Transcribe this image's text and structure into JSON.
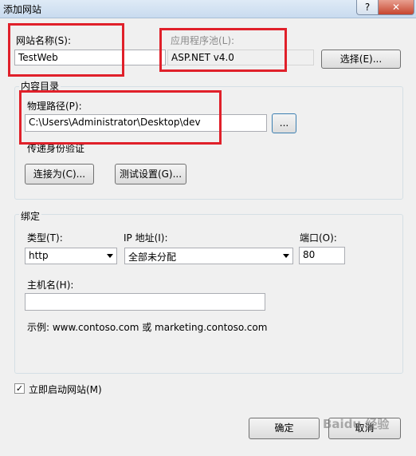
{
  "window": {
    "title": "添加网站",
    "help_label": "?",
    "close_label": "✕"
  },
  "site_name": {
    "label": "网站名称(S):",
    "value": "TestWeb"
  },
  "app_pool": {
    "label": "应用程序池(L):",
    "value": "ASP.NET v4.0",
    "select_button": "选择(E)..."
  },
  "content_dir": {
    "group_title": "内容目录",
    "physical_path_label": "物理路径(P):",
    "physical_path_value": "C:\\Users\\Administrator\\Desktop\\dev",
    "browse_button": "...",
    "pass_auth_label": "传递身份验证",
    "connect_as_button": "连接为(C)...",
    "test_settings_button": "测试设置(G)..."
  },
  "binding": {
    "group_title": "绑定",
    "type_label": "类型(T):",
    "type_value": "http",
    "ip_label": "IP 地址(I):",
    "ip_value": "全部未分配",
    "port_label": "端口(O):",
    "port_value": "80",
    "hostname_label": "主机名(H):",
    "hostname_value": "",
    "example": "示例: www.contoso.com 或 marketing.contoso.com"
  },
  "start_site": {
    "label": "立即启动网站(M)",
    "checked": true
  },
  "footer": {
    "ok_button": "确定",
    "cancel_button": "取消"
  },
  "watermark": "Baidu 经验",
  "colors": {
    "highlight": "#e0202a"
  }
}
